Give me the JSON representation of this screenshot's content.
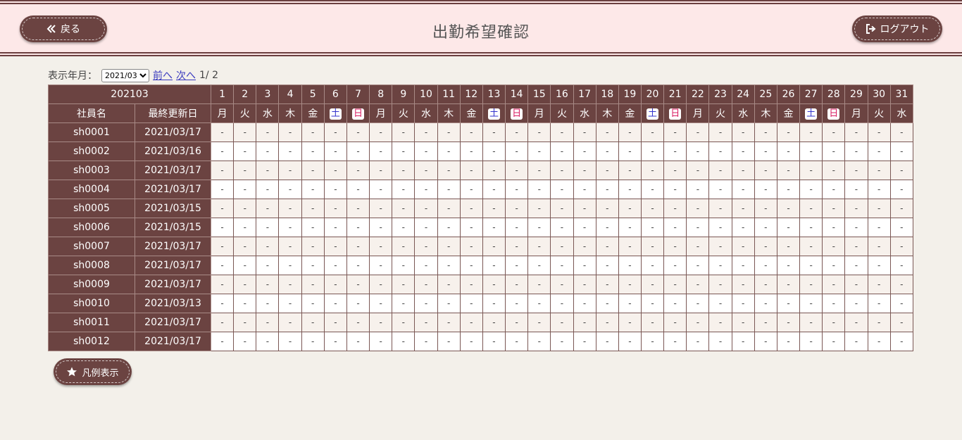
{
  "header": {
    "back_label": "戻る",
    "title": "出勤希望確認",
    "logout_label": "ログアウト"
  },
  "toolbar": {
    "month_label": "表示年月：",
    "selected_month": "2021/03",
    "prev_label": "前へ",
    "next_label": "次へ",
    "page_info": "1/ 2"
  },
  "table": {
    "year_month": "202103",
    "col_employee": "社員名",
    "col_updated": "最終更新日",
    "days": [
      {
        "d": "1",
        "w": "月"
      },
      {
        "d": "2",
        "w": "火"
      },
      {
        "d": "3",
        "w": "水"
      },
      {
        "d": "4",
        "w": "木"
      },
      {
        "d": "5",
        "w": "金"
      },
      {
        "d": "6",
        "w": "土"
      },
      {
        "d": "7",
        "w": "日"
      },
      {
        "d": "8",
        "w": "月"
      },
      {
        "d": "9",
        "w": "火"
      },
      {
        "d": "10",
        "w": "水"
      },
      {
        "d": "11",
        "w": "木"
      },
      {
        "d": "12",
        "w": "金"
      },
      {
        "d": "13",
        "w": "土"
      },
      {
        "d": "14",
        "w": "日"
      },
      {
        "d": "15",
        "w": "月"
      },
      {
        "d": "16",
        "w": "火"
      },
      {
        "d": "17",
        "w": "水"
      },
      {
        "d": "18",
        "w": "木"
      },
      {
        "d": "19",
        "w": "金"
      },
      {
        "d": "20",
        "w": "土"
      },
      {
        "d": "21",
        "w": "日"
      },
      {
        "d": "22",
        "w": "月"
      },
      {
        "d": "23",
        "w": "火"
      },
      {
        "d": "24",
        "w": "水"
      },
      {
        "d": "25",
        "w": "木"
      },
      {
        "d": "26",
        "w": "金"
      },
      {
        "d": "27",
        "w": "土"
      },
      {
        "d": "28",
        "w": "日"
      },
      {
        "d": "29",
        "w": "月"
      },
      {
        "d": "30",
        "w": "火"
      },
      {
        "d": "31",
        "w": "水"
      }
    ],
    "empty_mark": "-",
    "rows": [
      {
        "employee": "sh0001",
        "updated": "2021/03/17"
      },
      {
        "employee": "sh0002",
        "updated": "2021/03/16"
      },
      {
        "employee": "sh0003",
        "updated": "2021/03/17"
      },
      {
        "employee": "sh0004",
        "updated": "2021/03/17"
      },
      {
        "employee": "sh0005",
        "updated": "2021/03/15"
      },
      {
        "employee": "sh0006",
        "updated": "2021/03/15"
      },
      {
        "employee": "sh0007",
        "updated": "2021/03/17"
      },
      {
        "employee": "sh0008",
        "updated": "2021/03/17"
      },
      {
        "employee": "sh0009",
        "updated": "2021/03/17"
      },
      {
        "employee": "sh0010",
        "updated": "2021/03/13"
      },
      {
        "employee": "sh0011",
        "updated": "2021/03/17"
      },
      {
        "employee": "sh0012",
        "updated": "2021/03/17"
      }
    ]
  },
  "legend_label": "凡例表示",
  "colors": {
    "brand": "#6b4341",
    "header_bg": "#fde8e8",
    "saturday": "#3333cc",
    "sunday": "#d81b60"
  },
  "icons": {
    "back": "double-chevron-left-icon",
    "logout": "logout-icon",
    "legend": "star-icon"
  }
}
